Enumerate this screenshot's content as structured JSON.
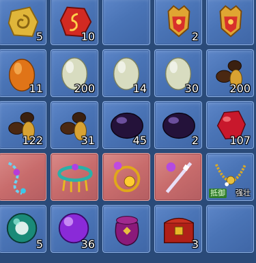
{
  "inventory": {
    "slots": [
      {
        "icon": "gold-spiral-coin-icon",
        "count": "5"
      },
      {
        "icon": "red-rune-gem-icon",
        "count": "10"
      },
      {
        "icon": "empty-slot",
        "count": ""
      },
      {
        "icon": "golden-red-helmet-icon",
        "count": "2"
      },
      {
        "icon": "golden-red-helmet-icon",
        "count": ""
      },
      {
        "icon": "orange-egg-icon",
        "count": "11"
      },
      {
        "icon": "pale-green-egg-icon",
        "count": "200"
      },
      {
        "icon": "pale-green-egg-icon",
        "count": "14"
      },
      {
        "icon": "pale-green-egg-icon",
        "count": "30"
      },
      {
        "icon": "brown-gold-beans-icon",
        "count": "200"
      },
      {
        "icon": "brown-gold-beans-icon",
        "count": "122"
      },
      {
        "icon": "brown-gold-beans-icon",
        "count": "31"
      },
      {
        "icon": "dark-purple-orb-icon",
        "count": "45"
      },
      {
        "icon": "dark-purple-orb-icon",
        "count": "2"
      },
      {
        "icon": "red-crystal-gem-icon",
        "count": "107"
      },
      {
        "icon": "blue-chain-necklace-icon",
        "count": "",
        "bound": true
      },
      {
        "icon": "teal-beaded-necklace-icon",
        "count": "",
        "bound": true
      },
      {
        "icon": "gold-amulet-necklace-icon",
        "count": "",
        "bound": true
      },
      {
        "icon": "crystal-wand-icon",
        "count": "",
        "bound": true
      },
      {
        "icon": "gold-pearl-necklace-icon",
        "count": "",
        "tag": "抵御",
        "tag_text": "强壮"
      },
      {
        "icon": "green-crystal-ball-icon",
        "count": "5"
      },
      {
        "icon": "purple-orb-icon",
        "count": "36"
      },
      {
        "icon": "purple-pouch-icon",
        "count": ""
      },
      {
        "icon": "red-treasure-chest-icon",
        "count": "3"
      },
      {
        "icon": "empty-slot",
        "count": ""
      }
    ]
  },
  "colors": {
    "slot_bg": "#4a74b6",
    "slot_bound_bg": "#c86c6c",
    "background": "#2a4a78",
    "tag_green": "#2f7d2a"
  }
}
